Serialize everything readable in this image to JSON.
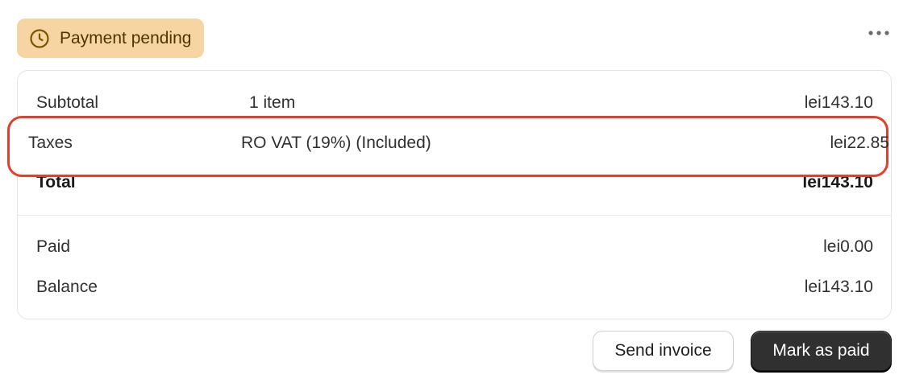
{
  "status_badge": {
    "label": "Payment pending",
    "icon": "clock-icon",
    "background": "#f6d5a3",
    "text_color": "#4f3500"
  },
  "more_actions": {
    "icon": "more-horizontal-icon"
  },
  "summary": {
    "rows": [
      {
        "label": "Subtotal",
        "detail": "1 item",
        "amount": "lei143.10"
      },
      {
        "label": "Taxes",
        "detail": "RO VAT (19%) (Included)",
        "amount": "lei22.85"
      },
      {
        "label": "Total",
        "detail": "",
        "amount": "lei143.10"
      }
    ],
    "payments": [
      {
        "label": "Paid",
        "amount": "lei0.00"
      },
      {
        "label": "Balance",
        "amount": "lei143.10"
      }
    ]
  },
  "highlight": {
    "color": "#e2402b"
  },
  "actions": {
    "send_invoice": "Send invoice",
    "mark_as_paid": "Mark as paid"
  }
}
